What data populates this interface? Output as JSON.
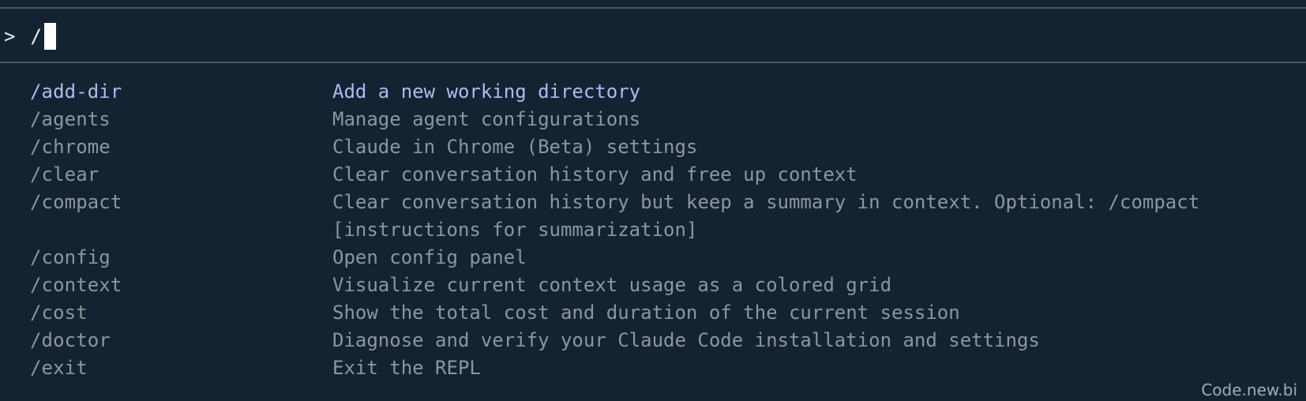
{
  "prompt": {
    "symbol": ">",
    "input_value": "/"
  },
  "commands": [
    {
      "name": "/add-dir",
      "description": "Add a new working directory",
      "selected": true
    },
    {
      "name": "/agents",
      "description": "Manage agent configurations",
      "selected": false
    },
    {
      "name": "/chrome",
      "description": "Claude in Chrome (Beta) settings",
      "selected": false
    },
    {
      "name": "/clear",
      "description": "Clear conversation history and free up context",
      "selected": false
    },
    {
      "name": "/compact",
      "description": "Clear conversation history but keep a summary in context. Optional: /compact [instructions for summarization]",
      "selected": false
    },
    {
      "name": "/config",
      "description": "Open config panel",
      "selected": false
    },
    {
      "name": "/context",
      "description": "Visualize current context usage as a colored grid",
      "selected": false
    },
    {
      "name": "/cost",
      "description": "Show the total cost and duration of the current session",
      "selected": false
    },
    {
      "name": "/doctor",
      "description": "Diagnose and verify your Claude Code installation and settings",
      "selected": false
    },
    {
      "name": "/exit",
      "description": "Exit the REPL",
      "selected": false
    }
  ],
  "watermark": "Code.new.bi",
  "colors": {
    "background": "#132332",
    "selected": "#b3b8f0",
    "text": "#8e969e",
    "divider": "#4a5866"
  }
}
